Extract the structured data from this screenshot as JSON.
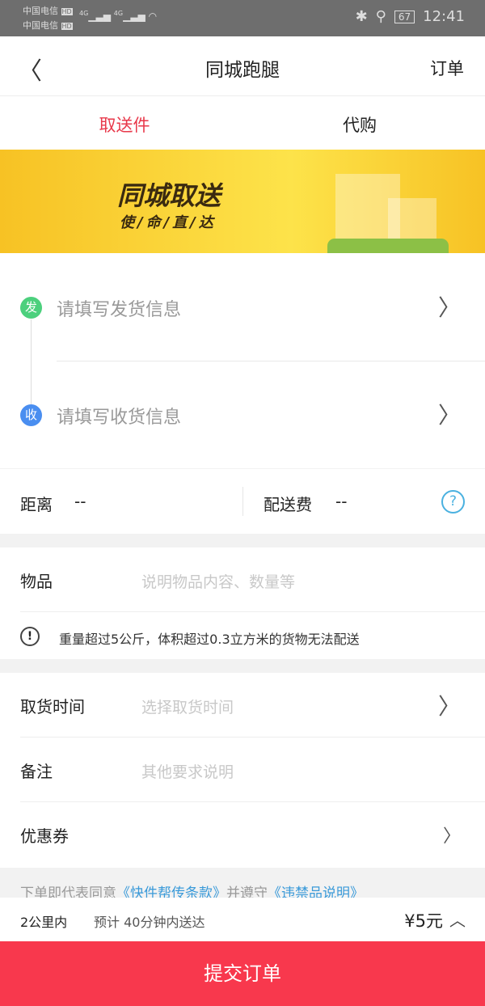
{
  "status_bar": {
    "carrier1": "中国电信",
    "carrier2": "中国电信",
    "hd": "HD",
    "net1": "4G",
    "net2": "4G",
    "battery": "67",
    "time": "12:41"
  },
  "nav": {
    "title": "同城跑腿",
    "orders": "订单"
  },
  "tabs": [
    {
      "label": "取送件",
      "active": true
    },
    {
      "label": "代购",
      "active": false
    }
  ],
  "banner": {
    "title": "同城取送",
    "subtitle": "使/命/直/达"
  },
  "address": {
    "sender_badge": "发",
    "sender_placeholder": "请填写发货信息",
    "receiver_badge": "收",
    "receiver_placeholder": "请填写收货信息",
    "sender_color": "#4cd07d",
    "receiver_color": "#4a8ef0"
  },
  "stats": {
    "distance_label": "距离",
    "distance_value": "--",
    "fee_label": "配送费",
    "fee_value": "--"
  },
  "item": {
    "label": "物品",
    "placeholder": "说明物品内容、数量等",
    "notice": "重量超过5公斤，体积超过0.3立方米的货物无法配送"
  },
  "fields": [
    {
      "label": "取货时间",
      "placeholder": "选择取货时间",
      "chevron": true
    },
    {
      "label": "备注",
      "placeholder": "其他要求说明",
      "chevron": false
    },
    {
      "label": "优惠券",
      "placeholder": "",
      "chevron": true
    }
  ],
  "terms": {
    "prefix": "下单即代表同意",
    "link1": "《快件帮传条款》",
    "middle": "并遵守",
    "link2": "《违禁品说明》"
  },
  "summary": {
    "range": "2公里内",
    "eta": "预计 40分钟内送达",
    "price": "¥5元"
  },
  "submit": "提交订单"
}
